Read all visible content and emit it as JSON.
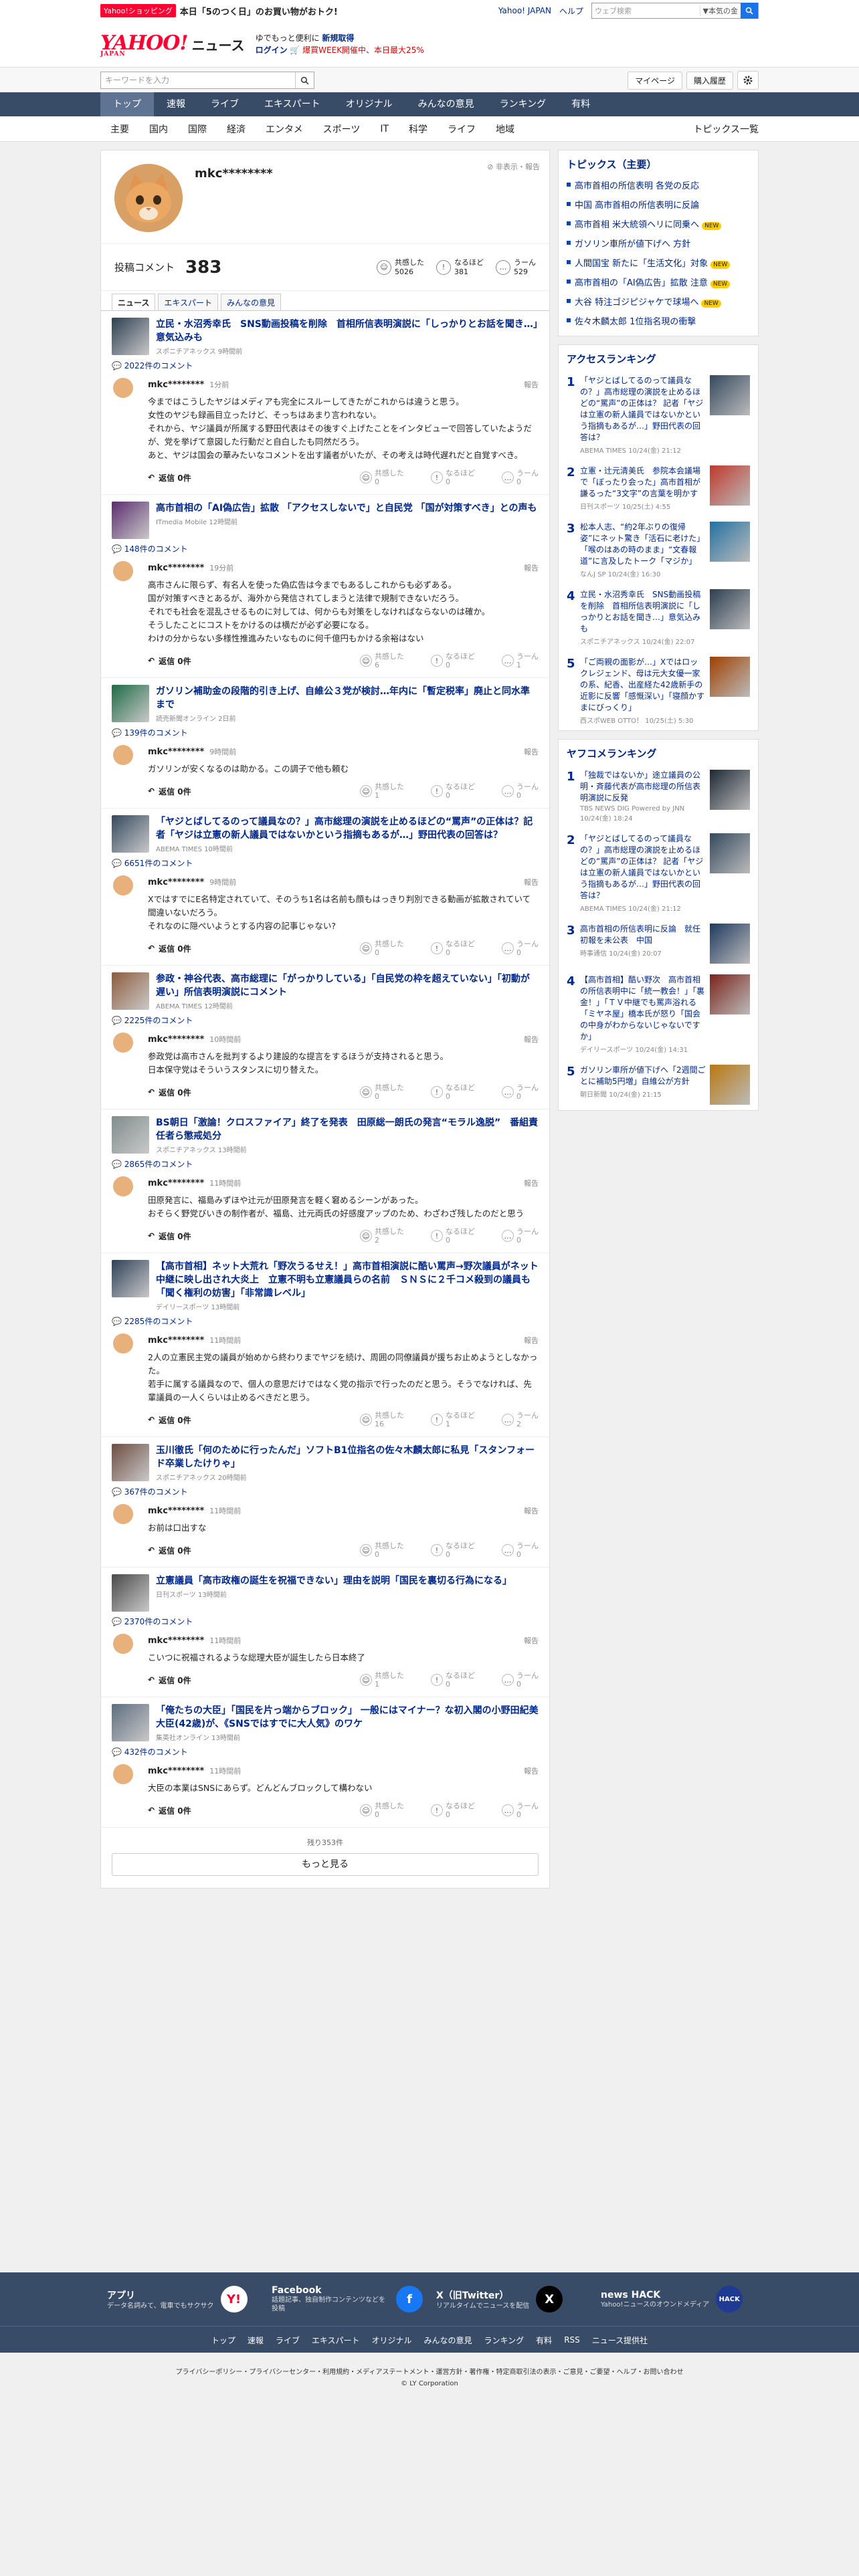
{
  "topbar": {
    "promo_tag": "Yahoo!ショッピング",
    "promo_text": "本日「5のつく日」のお買い物がおトク!",
    "links": [
      "Yahoo! JAPAN",
      "ヘルプ"
    ],
    "search_placeholder": "ウェブ検索",
    "search_select": "▼本気の金"
  },
  "header": {
    "logo": "YAHOO!",
    "logo_sub": "JAPAN",
    "section": "ニュース",
    "promo_line1": "ゆでもっと便利に",
    "promo_line1_link": "新規取得",
    "promo_line2_link": "ログイン",
    "promo_line2": "🛒 爆買WEEK開催中、本日最大25%"
  },
  "searchrow": {
    "placeholder": "キーワードを入力",
    "mypage": "マイページ",
    "history": "購入履歴"
  },
  "mainnav": [
    "トップ",
    "速報",
    "ライブ",
    "エキスパート",
    "オリジナル",
    "みんなの意見",
    "ランキング",
    "有料"
  ],
  "subnav": [
    "主要",
    "国内",
    "国際",
    "経済",
    "エンタメ",
    "スポーツ",
    "IT",
    "科学",
    "ライフ",
    "地域"
  ],
  "subnav_right": "トピックス一覧",
  "profile": {
    "username": "mkc********",
    "report": "非表示・報告",
    "comments_label": "投稿コメント",
    "comments_count": "383",
    "reactions": [
      {
        "icon": "☺",
        "label": "共感した",
        "count": "5026"
      },
      {
        "icon": "!",
        "label": "なるほど",
        "count": "381"
      },
      {
        "icon": "…",
        "label": "うーん",
        "count": "529"
      }
    ],
    "tabs": [
      "ニュース",
      "エキスパート",
      "みんなの意見"
    ]
  },
  "comments": [
    {
      "title": "立民・水沼秀幸氏　SNS動画投稿を削除　首相所信表明演説に「しっかりとお話を聞き…」意気込みも",
      "source": "スポニチアネックス 9時間前",
      "count": "2022件のコメント",
      "user": "mkc********",
      "time": "1分前",
      "text": "今まではこうしたヤジはメディアも完全にスルーしてきたがこれからは違うと思う。\n女性のヤジも録画目立ったけど、そっちはあまり言われない。\nそれから、ヤジ議員が所属する野田代表はその後すぐ上げたことをインタビューで回答していたようだが、党を挙げて意図した行動だと自白したも同然だろう。\nあと、ヤジは国会の華みたいなコメントを出す議者がいたが、その考えは時代遅れだと自覚すべき。",
      "reply": "返信 0件",
      "reacts": [
        "0",
        "0",
        "0"
      ],
      "thumb": "#2c3e50"
    },
    {
      "title": "高市首相の「AI偽広告」拡散 「アクセスしないで」と自民党 「国が対策すべき」との声も",
      "source": "ITmedia Mobile 12時間前",
      "count": "148件のコメント",
      "user": "mkc********",
      "time": "19分前",
      "text": "高市さんに限らず、有名人を使った偽広告は今までもあるしこれからも必ずある。\n国が対策すべきとあるが、海外から発信されてしまうと法律で規制できないだろう。\nそれでも社会を混乱させるものに対しては、何からも対策をしなければならないのは確か。\nそうしたことにコストをかけるのは横だが必ず必要になる。\nわけの分からない多様性推進みたいなものに何千億円もかける余裕はない",
      "reply": "返信 0件",
      "reacts": [
        "6",
        "0",
        "1"
      ],
      "thumb": "#5b2c6f"
    },
    {
      "title": "ガソリン補助金の段階的引き上げ、自維公３党が検討…年内に「暫定税率」廃止と同水準まで",
      "source": "読売新聞オンライン 2日前",
      "count": "139件のコメント",
      "user": "mkc********",
      "time": "9時間前",
      "text": "ガソリンが安くなるのは助かる。この調子で他も頼む",
      "reply": "返信 0件",
      "reacts": [
        "1",
        "0",
        "0"
      ],
      "thumb": "#1e6b44"
    },
    {
      "title": "「ヤジとばしてるのって議員なの？」高市総理の演説を止めるほどの“罵声”の正体は？記者「ヤジは立憲の新人議員ではないかという指摘もあるが…」野田代表の回答は？",
      "source": "ABEMA TIMES 10時間前",
      "count": "6651件のコメント",
      "user": "mkc********",
      "time": "9時間前",
      "text": "XではすでにE名特定されていて、そのうち1名は名前も顔もはっきり判別できる動画が拡散されていて間違いないだろう。\nそれなのに隠ぺいようとする内容の記事じゃない?",
      "reply": "返信 0件",
      "reacts": [
        "0",
        "0",
        "0"
      ],
      "thumb": "#34495e"
    },
    {
      "title": "参政・神谷代表、高市総理に「がっかりしている」「自民党の枠を超えていない」「初動が遅い」所信表明演説にコメント",
      "source": "ABEMA TIMES 12時間前",
      "count": "2225件のコメント",
      "user": "mkc********",
      "time": "10時間前",
      "text": "参政党は高市さんを批判するより建設的な提言をするほうが支持されると思う。\n日本保守党はそういうスタンスに切り替えた。",
      "reply": "返信 0件",
      "reacts": [
        "0",
        "0",
        "0"
      ],
      "thumb": "#8e5b3c"
    },
    {
      "title": "BS朝日「激論！クロスファイア」終了を発表　田原総一朗氏の発言“モラル逸脱”　番組責任者ら懲戒処分",
      "source": "スポニチアネックス 13時間前",
      "count": "2865件のコメント",
      "user": "mkc********",
      "time": "11時間前",
      "text": "田原発言に、福島みずほや辻元が田原発言を軽く窘めるシーンがあった。\nおそらく野党びいきの制作者が、福島、辻元両氏の好感度アップのため、わざわざ残したのだと思う",
      "reply": "返信 0件",
      "reacts": [
        "2",
        "0",
        "0"
      ],
      "thumb": "#7f8c8d"
    },
    {
      "title": "【高市首相】ネット大荒れ「野次うるせえ！」高市首相演説に酷い罵声→野次議員がネット中継に映し出され大炎上　立憲不明も立憲議員らの名前　ＳＮＳに２千コメ殺到の議員も「聞く権利の妨害」「非常識レベル」",
      "source": "デイリースポーツ 13時間前",
      "count": "2285件のコメント",
      "user": "mkc********",
      "time": "11時間前",
      "text": "2人の立憲民主党の議員が始めから終わりまでヤジを続け、周囲の同僚議員が援ちお止めようとしなかった。\n若手に属する議員なので、個人の意思だけではなく党の指示で行ったのだと思う。そうでなければ、先輩議員の一人くらいは止めるべきだと思う。",
      "reply": "返信 0件",
      "reacts": [
        "16",
        "1",
        "2"
      ],
      "thumb": "#2e4057"
    },
    {
      "title": "玉川徹氏「何のために行ったんだ」ソフトB1位指名の佐々木麟太郎に私見「スタンフォード卒業したけりゃ」",
      "source": "スポニチアネックス 20時間前",
      "count": "367件のコメント",
      "user": "mkc********",
      "time": "11時間前",
      "text": "お前は口出すな",
      "reply": "返信 0件",
      "reacts": [
        "0",
        "0",
        "0"
      ],
      "thumb": "#6d4c41"
    },
    {
      "title": "立憲議員「高市政権の誕生を祝福できない」理由を説明「国民を裏切る行為になる」",
      "source": "日刊スポーツ 13時間前",
      "count": "2370件のコメント",
      "user": "mkc********",
      "time": "11時間前",
      "text": "こいつに祝福されるような総理大臣が誕生したら日本終了",
      "reply": "返信 0件",
      "reacts": [
        "1",
        "0",
        "0"
      ],
      "thumb": "#4a4a4a"
    },
    {
      "title": "「俺たちの大臣」「国民を片っ端からブロック」 一般にはマイナー？な初入閣の小野田紀美大臣(42歳)が、《SNSではすでに大人気》のワケ",
      "source": "集英社オンライン 13時間前",
      "count": "432件のコメント",
      "user": "mkc********",
      "time": "11時間前",
      "text": "大臣の本業はSNSにあらず。どんどんブロックして構わない",
      "reply": "返信 0件",
      "reacts": [
        "0",
        "0",
        "0"
      ],
      "thumb": "#5d6d7e"
    }
  ],
  "more": {
    "remain": "残り353件",
    "button": "もっと見る"
  },
  "sidebar": {
    "topics_title": "トピックス（主要）",
    "topics": [
      {
        "text": "高市首相の所信表明 各党の反応",
        "new": ""
      },
      {
        "text": "中国 高市首相の所信表明に反論",
        "new": ""
      },
      {
        "text": "高市首相 米大統領ヘリに同乗へ",
        "new": "NEW"
      },
      {
        "text": "ガソリン車所が値下げへ 方針",
        "new": ""
      },
      {
        "text": "人間国宝 新たに「生活文化」対象",
        "new": "NEW"
      },
      {
        "text": "高市首相の「AI偽広告」拡散 注意",
        "new": "NEW"
      },
      {
        "text": "大谷 特注ゴジピジャケで球場へ",
        "new": "NEW"
      },
      {
        "text": "佐々木麟太郎 1位指名現の衝撃",
        "new": ""
      }
    ],
    "access_title": "アクセスランキング",
    "access": [
      {
        "rank": "1",
        "title": "「ヤジとばしてるのって議員なの？」高市総理の演説を止めるほどの“罵声”の正体は？ 記者「ヤジは立憲の新人議員ではないかという指摘もあるが…」野田代表の回答は？",
        "meta": "ABEMA TIMES 10/24(金) 21:12",
        "thumb": "#34495e"
      },
      {
        "rank": "2",
        "title": "立憲・辻元清美氏　参院本会議場で「ぼったり会った」高市首相が謙るった“3文字”の言葉を明かす",
        "meta": "日刊スポーツ 10/25(土) 4:55",
        "thumb": "#c0392b"
      },
      {
        "rank": "3",
        "title": "松本人志、“約2年ぶりの復帰姿”にネット驚き「活石に老けた」「喉のはあの時のまま」“文春報道”に言及したトーク「マジか」",
        "meta": "なんJ SP 10/24(金) 16:30",
        "thumb": "#2471a3"
      },
      {
        "rank": "4",
        "title": "立民・水沼秀幸氏　SNS動画投稿を削除　首相所信表明演説に「しっかりとお話を聞き…」意気込みも",
        "meta": "スポニチアネックス 10/24(金) 22:07",
        "thumb": "#2c3e50"
      },
      {
        "rank": "5",
        "title": "「ご両親の面影が…」Xではロックレジェンド、母は元大女優一家の系、紀香、出産経た42歳新手の近影に反響「感慨深い」「寝顔かすまにびっくり」",
        "meta": "西スポWEB OTTO！ 10/25(土) 5:30",
        "thumb": "#a04000"
      }
    ],
    "yafuco_title": "ヤフコメランキング",
    "yafuco": [
      {
        "rank": "1",
        "title": "「独裁ではないか」途立議員の公明・斉藤代表が高市総理の所信表明演説に反発",
        "meta": "TBS NEWS DIG Powered by JNN 10/24(金) 18:24",
        "thumb": "#1c2833"
      },
      {
        "rank": "2",
        "title": "「ヤジとばしてるのって議員なの？」高市総理の演説を止めるほどの“罵声”の正体は？ 記者「ヤジは立憲の新人議員ではないかという指摘もあるが…」野田代表の回答は？",
        "meta": "ABEMA TIMES 10/24(金) 21:12",
        "thumb": "#34495e"
      },
      {
        "rank": "3",
        "title": "高市首相の所信表明に反論　就任初報を未公表　中国",
        "meta": "時事通信 10/24(金) 20:07",
        "thumb": "#1f3a5f"
      },
      {
        "rank": "4",
        "title": "【高市首相】酷い野次　高市首相の所信表明中に「統一教会！」「裏金！」「ＴＶ中継でも罵声浴れる「ミヤネ屋」橋本氏が怒り「国会の中身がわからないじゃないですか」",
        "meta": "デイリースポーツ 10/24(金) 14:31",
        "thumb": "#7b241c"
      },
      {
        "rank": "5",
        "title": "ガソリン車所が値下げへ「2週間ごとに補助5円増」自維公が方針",
        "meta": "朝日新聞 10/24(金) 21:15",
        "thumb": "#b9770e"
      }
    ]
  },
  "footer": {
    "apps": [
      {
        "title": "アプリ",
        "desc": "データ名詞みて、電車でもサクサク",
        "icon": "Y!",
        "color": "#ffffff",
        "fg": "#ff0033"
      },
      {
        "title": "Facebook",
        "desc": "話題記事、独自制作コンテンツなどを投稿",
        "icon": "f",
        "color": "#1877f2",
        "fg": "#ffffff"
      },
      {
        "title": "X（旧Twitter）",
        "desc": "リアルタイムでニュースを配信",
        "icon": "X",
        "color": "#000000",
        "fg": "#ffffff"
      },
      {
        "title": "news HACK",
        "desc": "Yahoo!ニュースのオウンドメディア",
        "icon": "HACK",
        "color": "#1f3a93",
        "fg": "#ffffff"
      }
    ],
    "nav": [
      "トップ",
      "速報",
      "ライブ",
      "エキスパート",
      "オリジナル",
      "みんなの意見",
      "ランキング",
      "有料",
      "RSS",
      "ニュース提供社"
    ],
    "links": "プライバシーポリシー・プライバシーセンター・利用規約・メディアステートメント・運営方針・著作権・特定商取引法の表示・ご意見・ご要望・ヘルプ・お問い合わせ",
    "copyright": "© LY Corporation"
  },
  "colors": {
    "brand": "#ff0033",
    "nav_bg": "#384c68",
    "link": "#00278c"
  }
}
